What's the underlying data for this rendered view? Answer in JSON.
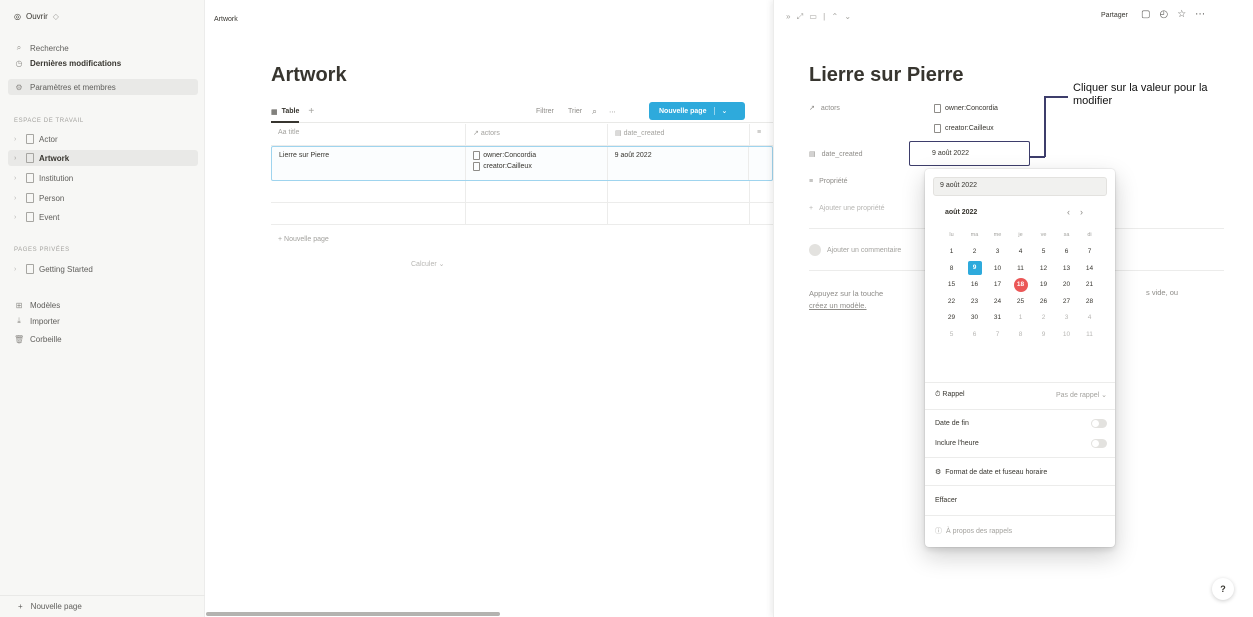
{
  "sidebar": {
    "workspace": "Ouvrir",
    "search": "Recherche",
    "recent": "Dernières modifications",
    "settings": "Paramètres et membres",
    "workspace_section": "ESPACE DE TRAVAIL",
    "pages": [
      "Actor",
      "Artwork",
      "Institution",
      "Person",
      "Event"
    ],
    "private_section": "PAGES PRIVÉES",
    "private_pages": [
      "Getting Started"
    ],
    "templates": "Modèles",
    "import": "Importer",
    "trash": "Corbeille",
    "new_page": "Nouvelle page"
  },
  "main": {
    "breadcrumb": "Artwork",
    "title": "Artwork",
    "view_label": "Table",
    "filter": "Filtrer",
    "sort": "Trier",
    "new_button": "Nouvelle page",
    "columns": [
      "title",
      "actors",
      "date_created"
    ],
    "rows": [
      {
        "title": "Lierre sur Pierre",
        "actors": [
          "owner:Concordia",
          "creator:Cailleux"
        ],
        "date": "9 août 2022"
      }
    ],
    "new_row": "+ Nouvelle page",
    "calc": "Calculer"
  },
  "peek": {
    "share": "Partager",
    "title": "Lierre sur Pierre",
    "prop_actors": "actors",
    "actor_values": [
      "owner:Concordia",
      "creator:Cailleux"
    ],
    "prop_date": "date_created",
    "date_value": "9 août 2022",
    "prop_propriete": "Propriété",
    "add_property": "Ajouter une propriété",
    "add_comment": "Ajouter un commentaire",
    "body_text": "Appuyez sur la touche",
    "body_link": "créez un modèle.",
    "body_tail": "s vide, ou"
  },
  "annotation": {
    "text": "Cliquer sur la valeur pour la modifier"
  },
  "picker": {
    "input_value": "9 août 2022",
    "month": "août 2022",
    "weekdays": [
      "lu",
      "ma",
      "me",
      "je",
      "ve",
      "sa",
      "di"
    ],
    "weeks": [
      [
        "1",
        "2",
        "3",
        "4",
        "5",
        "6",
        "7"
      ],
      [
        "8",
        "9",
        "10",
        "11",
        "12",
        "13",
        "14"
      ],
      [
        "15",
        "16",
        "17",
        "18",
        "19",
        "20",
        "21"
      ],
      [
        "22",
        "23",
        "24",
        "25",
        "26",
        "27",
        "28"
      ],
      [
        "29",
        "30",
        "31",
        "1",
        "2",
        "3",
        "4"
      ],
      [
        "5",
        "6",
        "7",
        "8",
        "9",
        "10",
        "11"
      ]
    ],
    "selected_day": "9",
    "today_day": "18",
    "reminder_label": "Rappel",
    "reminder_value": "Pas de rappel",
    "end_date": "Date de fin",
    "include_time": "Inclure l'heure",
    "format": "Format de date et fuseau horaire",
    "clear": "Effacer",
    "about": "À propos des rappels",
    "colors": {
      "selected": "#2eaadc",
      "today": "#eb5757"
    }
  },
  "help": "?"
}
